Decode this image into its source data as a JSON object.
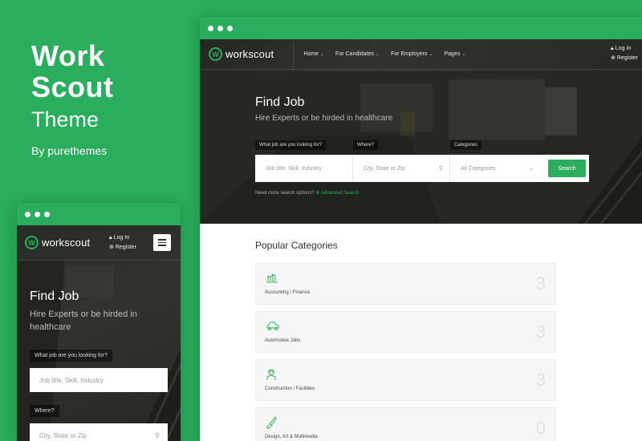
{
  "brand": {
    "line1": "Work",
    "line2": "Scout",
    "line3": "Theme",
    "byline": "By purethemes"
  },
  "colors": {
    "accent": "#2aad5c",
    "white": "#ffffff",
    "text_dark": "#333333"
  },
  "desktop": {
    "logo_text": "workscout",
    "logo_mark": "W",
    "menu": [
      {
        "label": "Home"
      },
      {
        "label": "For Candidates"
      },
      {
        "label": "For Employers"
      },
      {
        "label": "Pages"
      }
    ],
    "account": {
      "login": "Log In",
      "register": "Register"
    },
    "hero": {
      "title": "Find Job",
      "subtitle": "Hire Experts or be hirded in healthcare",
      "label_what": "What job are you looking for?",
      "label_where": "Where?",
      "label_categories": "Categories",
      "placeholder_what": "Job title, Skill, Industry",
      "placeholder_where": "City, State or Zip",
      "categories_value": "All Categories",
      "search_button": "Search",
      "advanced_prefix": "Need more search options?",
      "advanced_link": "Advanced Search"
    },
    "popular": {
      "title": "Popular Categories",
      "items": [
        {
          "label": "Accounting / Finance",
          "count": "3",
          "icon": "chart-icon"
        },
        {
          "label": "Automotive Jobs",
          "count": "3",
          "icon": "car-icon"
        },
        {
          "label": "Construction / Facilities",
          "count": "3",
          "icon": "worker-icon"
        },
        {
          "label": "Design, Art & Multimedia",
          "count": "0",
          "icon": "brush-icon"
        }
      ]
    }
  },
  "mobile": {
    "logo_text": "workscout",
    "logo_mark": "W",
    "account": {
      "login": "Log In",
      "register": "Register"
    },
    "hero": {
      "title": "Find Job",
      "subtitle": "Hire Experts or be hirded in healthcare",
      "label_what": "What job are you looking for?",
      "placeholder_what": "Job title, Skill, Industry",
      "label_where": "Where?",
      "placeholder_where": "City, State or Zip"
    }
  }
}
